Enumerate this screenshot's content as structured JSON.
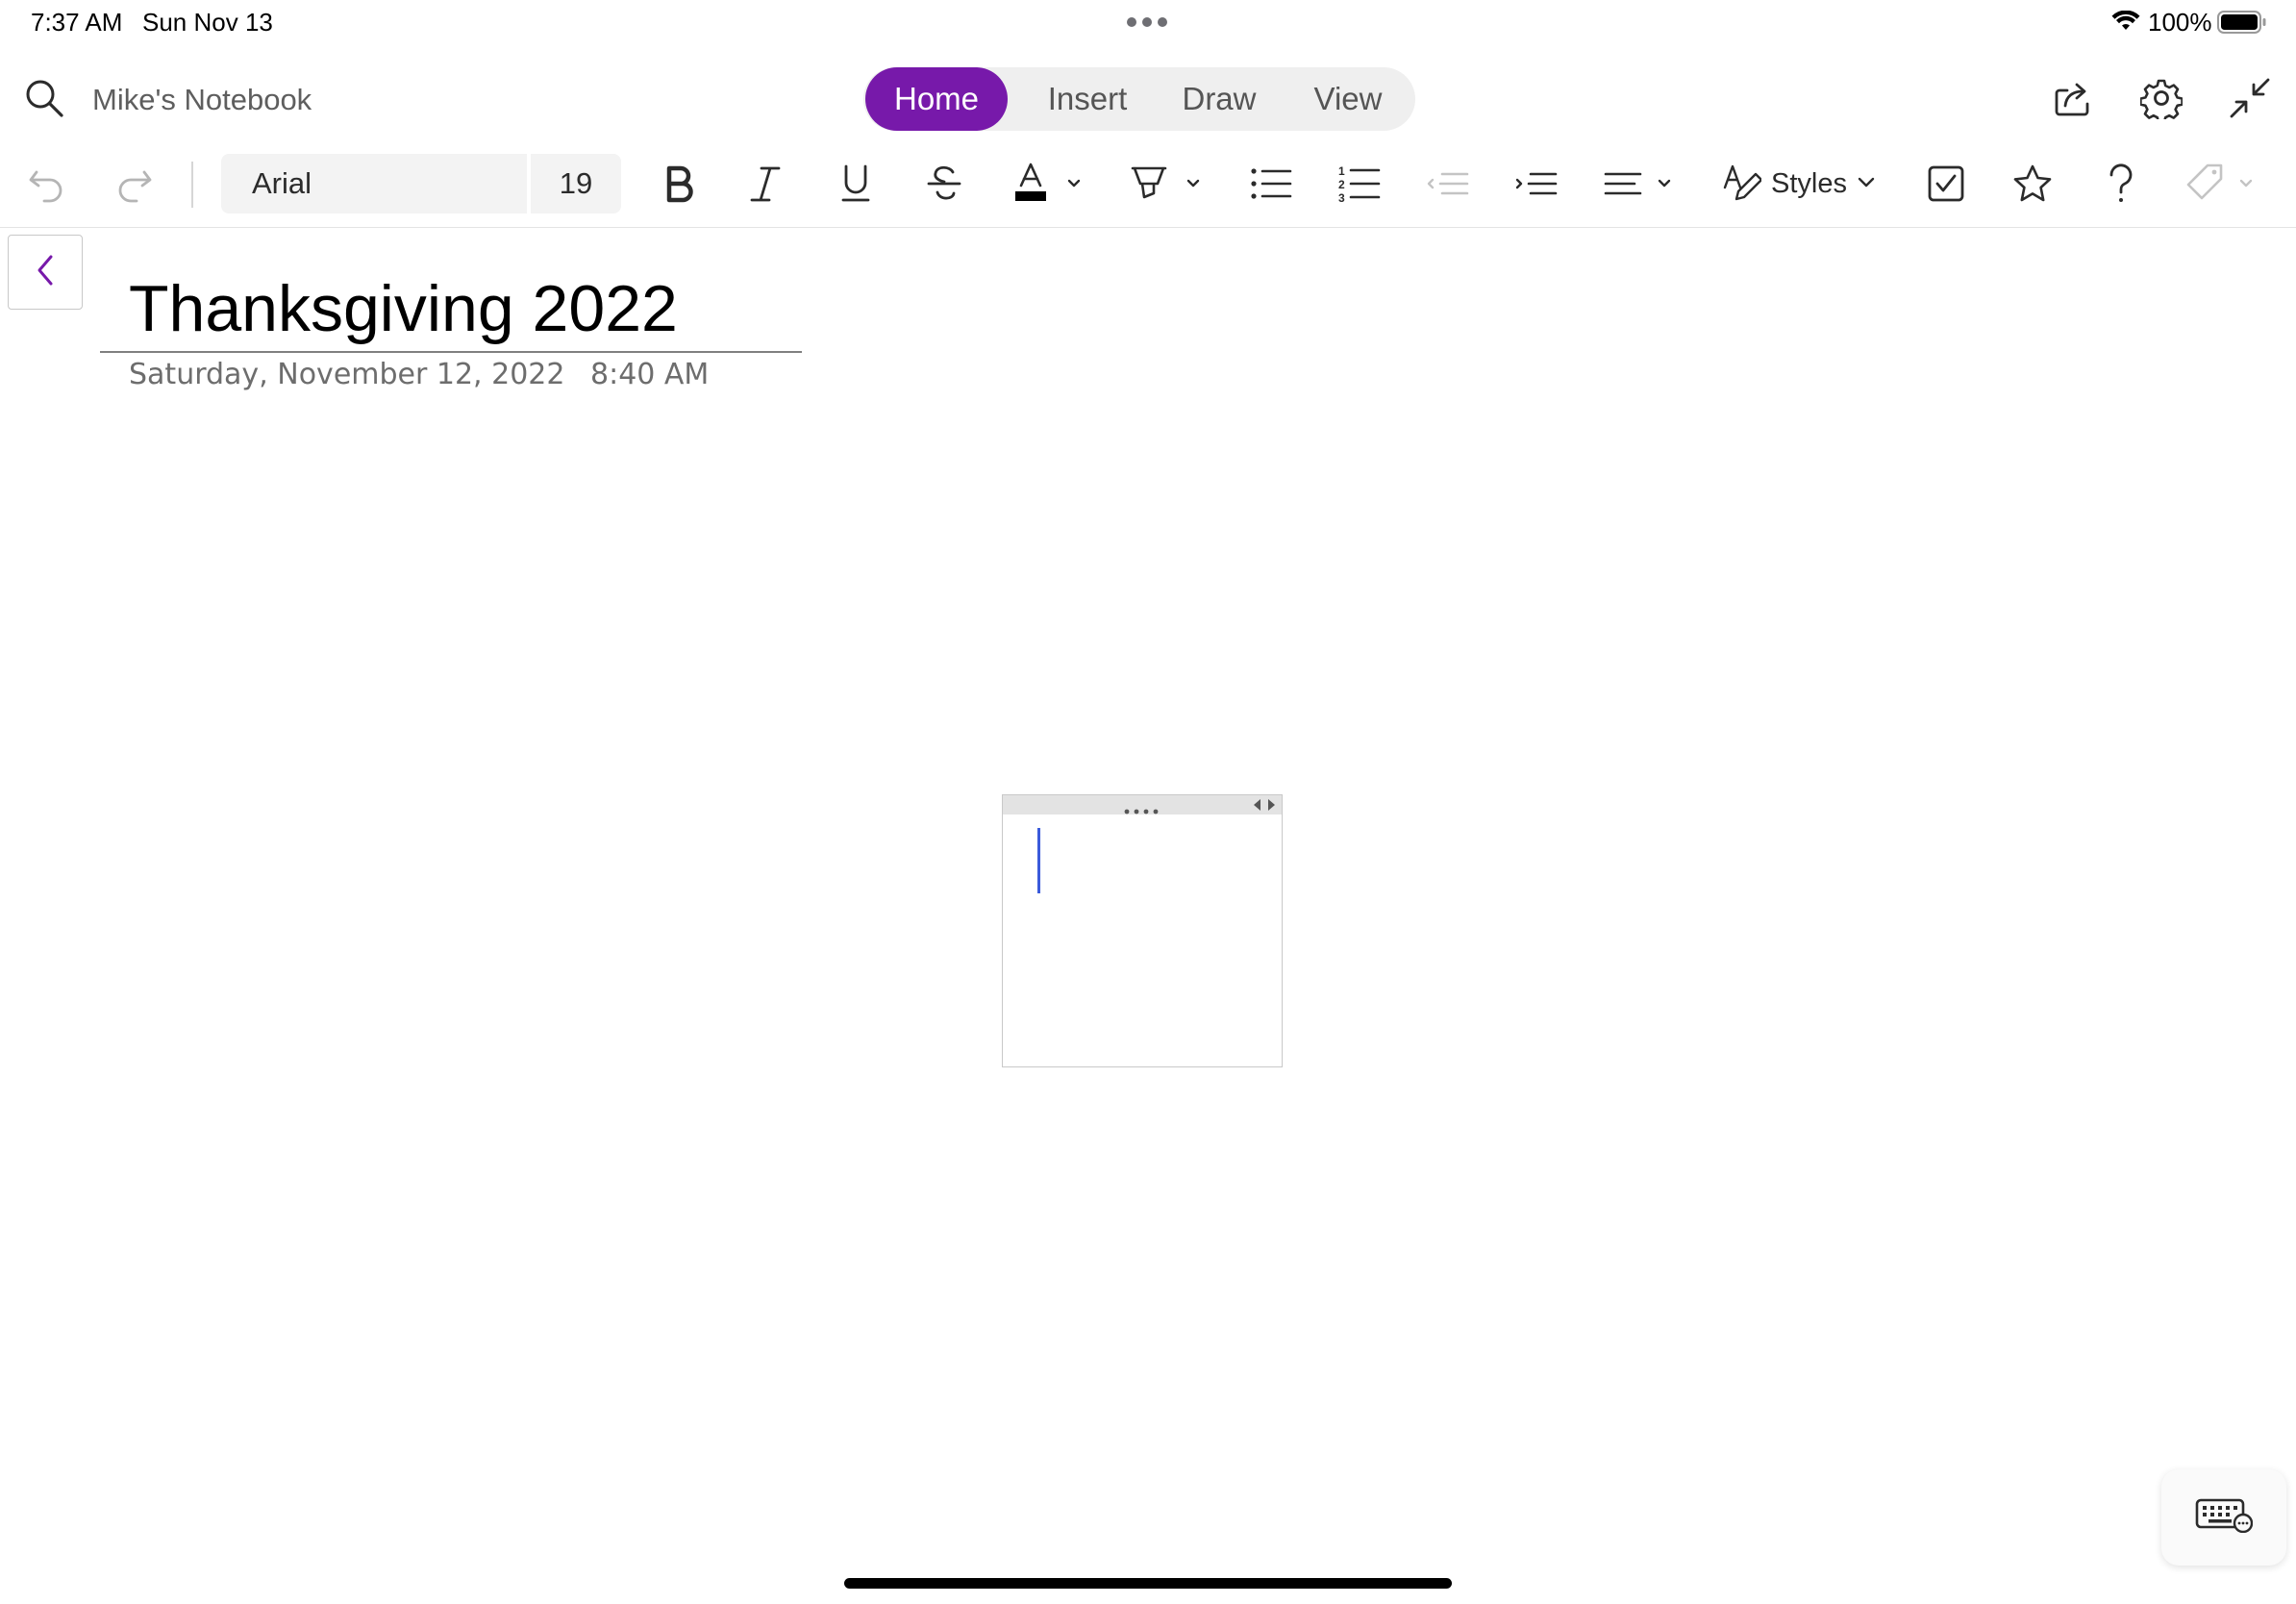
{
  "status_bar": {
    "time": "7:37 AM",
    "date": "Sun Nov 13",
    "battery": "100%",
    "icons": [
      "wifi-icon",
      "battery-icon"
    ]
  },
  "top_bar": {
    "notebook_name": "Mike's Notebook",
    "tabs": [
      {
        "label": "Home",
        "active": true
      },
      {
        "label": "Insert",
        "active": false
      },
      {
        "label": "Draw",
        "active": false
      },
      {
        "label": "View",
        "active": false
      }
    ],
    "right_icons": [
      "share-icon",
      "settings-gear-icon",
      "collapse-icon"
    ]
  },
  "ribbon": {
    "font_name": "Arial",
    "font_size": "19",
    "styles_label": "Styles",
    "buttons": [
      "undo",
      "redo",
      "bold",
      "italic",
      "underline",
      "strikethrough",
      "font-color",
      "highlight",
      "bullet-list",
      "numbered-list",
      "decrease-indent",
      "increase-indent",
      "align",
      "styles",
      "todo-checkbox",
      "important-star",
      "question",
      "tag"
    ]
  },
  "page": {
    "title": "Thanksgiving 2022",
    "date": "Saturday, November 12, 2022",
    "time": "8:40 AM"
  },
  "colors": {
    "accent": "#7719aa",
    "cursor": "#3b5bdb"
  }
}
